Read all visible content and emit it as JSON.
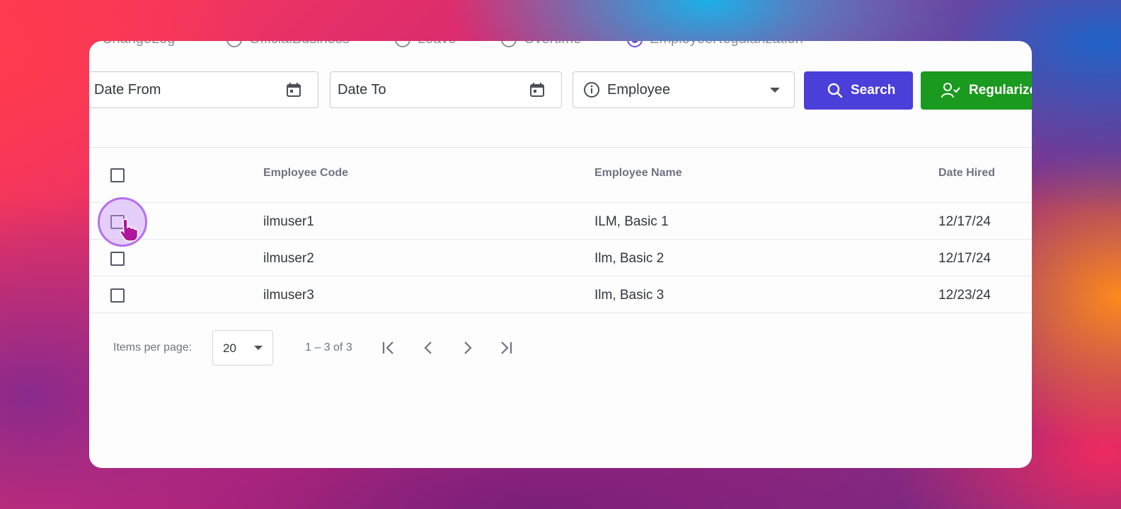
{
  "radio_filters": {
    "options": [
      "ChangeLog",
      "OfficialBusiness",
      "Leave",
      "Overtime",
      "EmployeeRegularization"
    ],
    "selected": "EmployeeRegularization"
  },
  "toolbar": {
    "date_from_label": "Date From",
    "date_to_label": "Date To",
    "employee_label": "Employee",
    "search_label": "Search",
    "regularize_label": "Regularize"
  },
  "table": {
    "columns": [
      "Employee Code",
      "Employee Name",
      "Date Hired"
    ],
    "rows": [
      {
        "code": "ilmuser1",
        "name": "ILM, Basic 1",
        "date_hired": "12/17/24"
      },
      {
        "code": "ilmuser2",
        "name": "Ilm, Basic 2",
        "date_hired": "12/17/24"
      },
      {
        "code": "ilmuser3",
        "name": "Ilm, Basic 3",
        "date_hired": "12/23/24"
      }
    ]
  },
  "paginator": {
    "items_per_page_label": "Items per page:",
    "page_size": "20",
    "range_label": "1 – 3 of 3"
  },
  "colors": {
    "search_button": "#4a3fd8",
    "regularize_button": "#1a9a1e",
    "radio_selected": "#6b4fd6",
    "cursor_highlight": "#b56fea"
  }
}
